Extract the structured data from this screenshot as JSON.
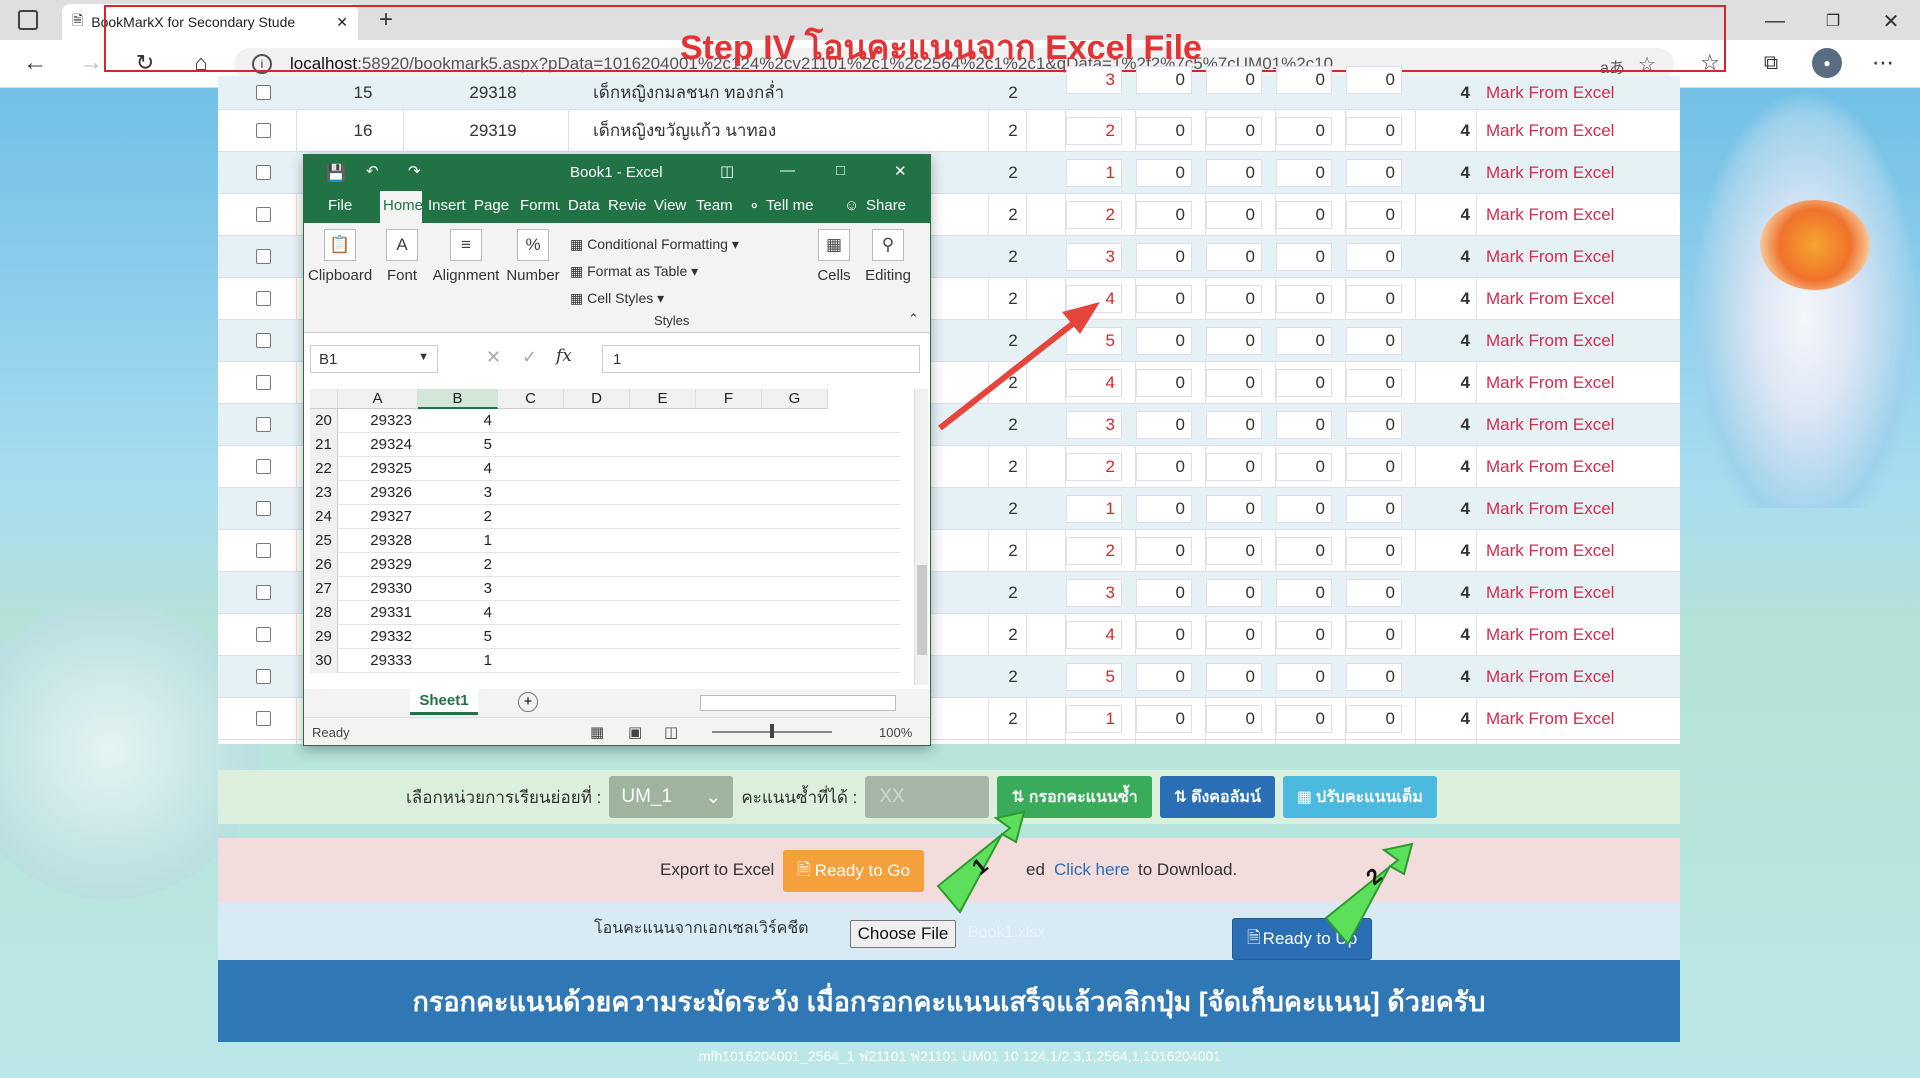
{
  "browser": {
    "tab_title": "BookMarkX for Secondary Stude",
    "url_host": "localhost",
    "url_rest": ":58920/bookmark5.aspx?pData=1016204001%2c124%2cv21101%2c1%2c2564%2c1%2c1&qData=1%2f2%7c5%7cUM01%2c10",
    "lang_icon": "aあ"
  },
  "annotation": {
    "title": "Step IV โอนคะแนนจาก Excel File",
    "marker1": "1",
    "marker2": "2"
  },
  "table": {
    "top_row": {
      "no": "15",
      "id": "29318",
      "name": "เด็กหญิงกมลชนก ทองกล่ำ",
      "col": "2",
      "score": "3",
      "o2": "0",
      "o3": "0",
      "o4": "0",
      "o5": "0",
      "total": "4",
      "mark": "Mark From Excel"
    },
    "rows": [
      {
        "no": "16",
        "id": "29319",
        "name": "เด็กหญิงขวัญแก้ว นาทอง",
        "col": "2",
        "score": "2",
        "z": "0",
        "total": "4",
        "mark": "Mark From Excel"
      },
      {
        "col": "2",
        "score": "1",
        "z": "0",
        "total": "4",
        "mark": "Mark From Excel"
      },
      {
        "col": "2",
        "score": "2",
        "z": "0",
        "total": "4",
        "mark": "Mark From Excel"
      },
      {
        "col": "2",
        "score": "3",
        "z": "0",
        "total": "4",
        "mark": "Mark From Excel"
      },
      {
        "col": "2",
        "score": "4",
        "z": "0",
        "total": "4",
        "mark": "Mark From Excel"
      },
      {
        "col": "2",
        "score": "5",
        "z": "0",
        "total": "4",
        "mark": "Mark From Excel"
      },
      {
        "col": "2",
        "score": "4",
        "z": "0",
        "total": "4",
        "mark": "Mark From Excel"
      },
      {
        "col": "2",
        "score": "3",
        "z": "0",
        "total": "4",
        "mark": "Mark From Excel"
      },
      {
        "col": "2",
        "score": "2",
        "z": "0",
        "total": "4",
        "mark": "Mark From Excel"
      },
      {
        "col": "2",
        "score": "1",
        "z": "0",
        "total": "4",
        "mark": "Mark From Excel"
      },
      {
        "col": "2",
        "score": "2",
        "z": "0",
        "total": "4",
        "mark": "Mark From Excel"
      },
      {
        "col": "2",
        "score": "3",
        "z": "0",
        "total": "4",
        "mark": "Mark From Excel"
      },
      {
        "col": "2",
        "score": "4",
        "z": "0",
        "total": "4",
        "mark": "Mark From Excel"
      },
      {
        "col": "2",
        "score": "5",
        "z": "0",
        "total": "4",
        "mark": "Mark From Excel"
      },
      {
        "col": "2",
        "score": "1",
        "z": "0",
        "total": "4",
        "mark": "Mark From Excel"
      }
    ]
  },
  "controls": {
    "unit_label": "เลือกหน่วยการเรียนย่อยที่ :",
    "unit_value": "UM_1",
    "repeat_label": "คะแนนซ้ำที่ได้ :",
    "repeat_placeholder": "XX",
    "fill_btn": "กรอกคะแนนซ้ำ",
    "pull_btn": "ดึงคอลัมน์",
    "adjust_btn": "ปรับคะแนนเต็ม"
  },
  "export": {
    "label": "Export to Excel",
    "ready_btn": "Ready to Go",
    "mid_text": "ed",
    "link": "Click here",
    "tail": "to Download."
  },
  "import": {
    "label": "โอนคะแนนจากเอกเซลเวิร์คชีต",
    "choose_btn": "Choose File",
    "file_name": "Book1.xlsx",
    "up_btn": "Ready to Up"
  },
  "banner": "กรอกคะแนนด้วยความระมัดระวัง เมื่อกรอกคะแนนเสร็จแล้วคลิกปุ่ม [จัดเก็บคะแนน] ด้วยครับ",
  "footer": "mfh1016204001_2564_1 ฟ21101 ฟ21101 UM01 10 124,1/2,3,1,2564,1,1016204001",
  "excel": {
    "title": "Book1 - Excel",
    "tabs": [
      "File",
      "Home",
      "Insert",
      "Page",
      "Formu",
      "Data",
      "Revie",
      "View",
      "Team"
    ],
    "tell_me": "Tell me",
    "share": "Share",
    "ribbon": {
      "clipboard": "Clipboard",
      "font": "Font",
      "alignment": "Alignment",
      "number": "Number",
      "cond": "Conditional Formatting",
      "fmt_table": "Format as Table",
      "cell_styles": "Cell Styles",
      "styles": "Styles",
      "cells": "Cells",
      "editing": "Editing"
    },
    "name_box": "B1",
    "formula": "1",
    "columns": [
      "A",
      "B",
      "C",
      "D",
      "E",
      "F",
      "G"
    ],
    "rows": [
      {
        "n": "20",
        "a": "29323",
        "b": "4"
      },
      {
        "n": "21",
        "a": "29324",
        "b": "5"
      },
      {
        "n": "22",
        "a": "29325",
        "b": "4"
      },
      {
        "n": "23",
        "a": "29326",
        "b": "3"
      },
      {
        "n": "24",
        "a": "29327",
        "b": "2"
      },
      {
        "n": "25",
        "a": "29328",
        "b": "1"
      },
      {
        "n": "26",
        "a": "29329",
        "b": "2"
      },
      {
        "n": "27",
        "a": "29330",
        "b": "3"
      },
      {
        "n": "28",
        "a": "29331",
        "b": "4"
      },
      {
        "n": "29",
        "a": "29332",
        "b": "5"
      },
      {
        "n": "30",
        "a": "29333",
        "b": "1"
      }
    ],
    "sheet": "Sheet1",
    "status": "Ready",
    "zoom": "100%"
  }
}
